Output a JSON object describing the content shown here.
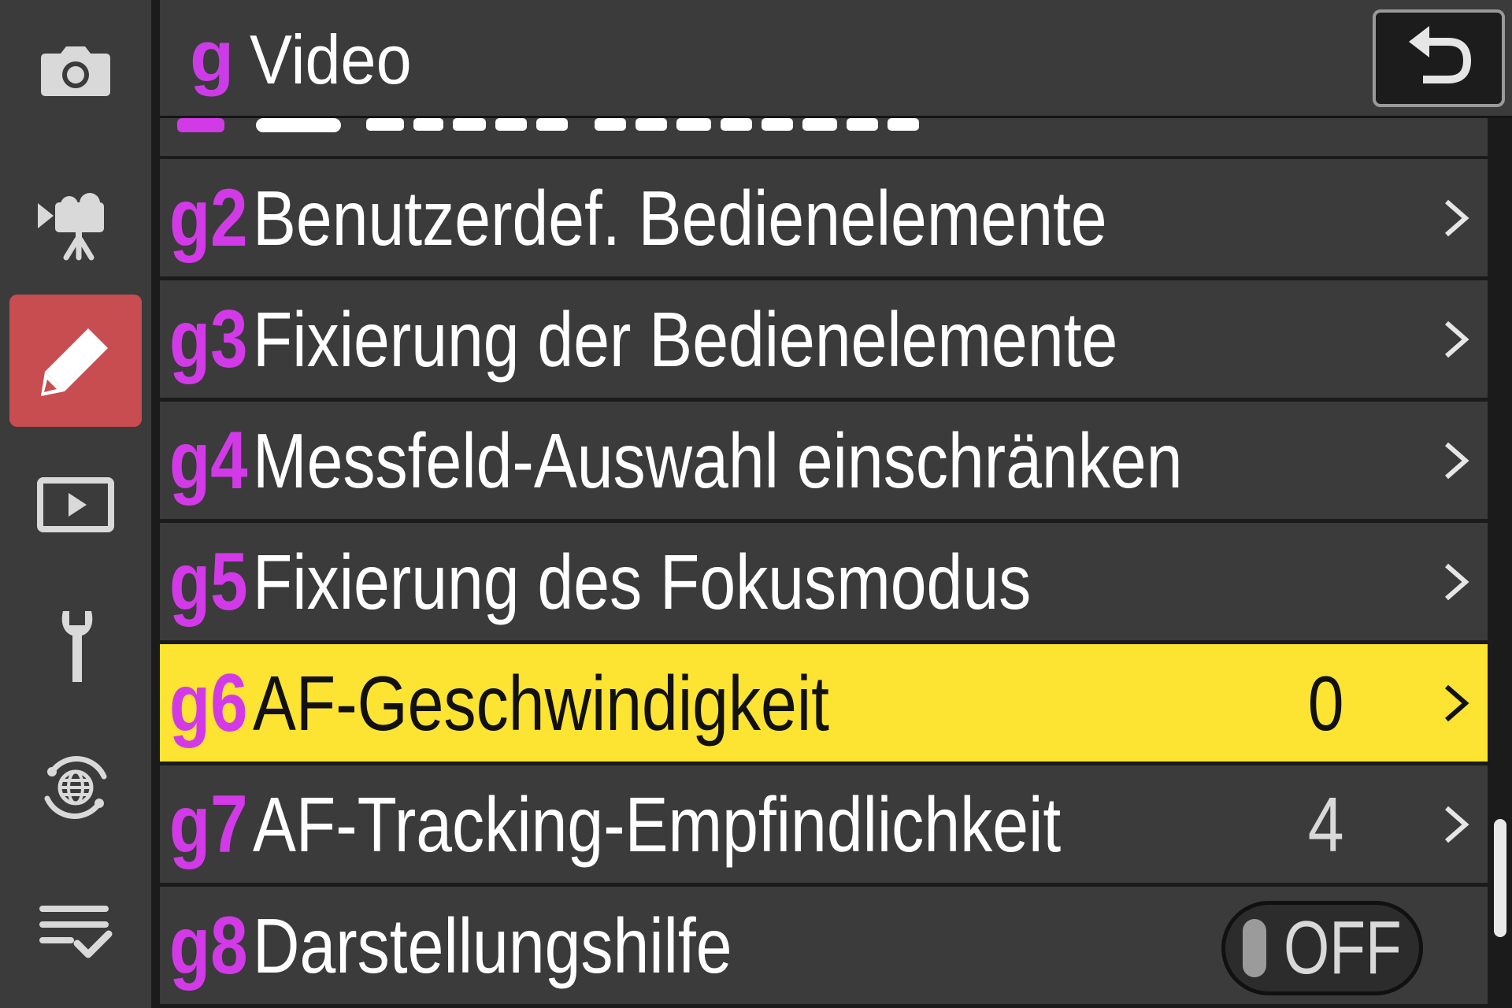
{
  "header": {
    "code": "g",
    "title": "Video"
  },
  "icons": {
    "tabs": [
      "camera-icon",
      "movie-icon",
      "pencil-icon",
      "playback-icon",
      "wrench-icon",
      "network-icon",
      "my-menu-icon"
    ],
    "back": "return-arrow-icon",
    "row_chevron": "chevron-right-icon"
  },
  "colors": {
    "accent_magenta": "#d23ae8",
    "active_tab": "#c84d50",
    "selected_row": "#fde332",
    "panel": "#3b3b3b"
  },
  "menu": {
    "items": [
      {
        "code": "g2",
        "label": "Benutzerdef. Bedienelemente",
        "value": ""
      },
      {
        "code": "g3",
        "label": "Fixierung der Bedienelemente",
        "value": ""
      },
      {
        "code": "g4",
        "label": "Messfeld-Auswahl einschränken",
        "value": ""
      },
      {
        "code": "g5",
        "label": "Fixierung des Fokusmodus",
        "value": ""
      },
      {
        "code": "g6",
        "label": "AF-Geschwindigkeit",
        "value": "0"
      },
      {
        "code": "g7",
        "label": "AF-Tracking-Empfindlichkeit",
        "value": "4"
      },
      {
        "code": "g8",
        "label": "Darstellungshilfe",
        "value": "OFF"
      }
    ]
  }
}
